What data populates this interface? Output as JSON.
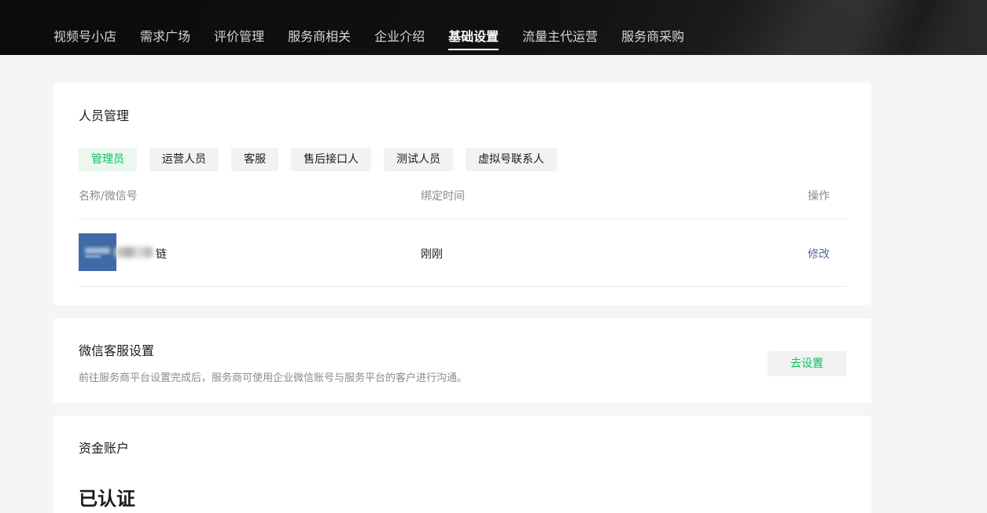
{
  "nav": {
    "items": [
      {
        "label": "视频号小店"
      },
      {
        "label": "需求广场"
      },
      {
        "label": "评价管理"
      },
      {
        "label": "服务商相关"
      },
      {
        "label": "企业介绍"
      },
      {
        "label": "基础设置",
        "active": true
      },
      {
        "label": "流量主代运营"
      },
      {
        "label": "服务商采购"
      }
    ]
  },
  "personnel": {
    "title": "人员管理",
    "tabs": [
      {
        "label": "管理员",
        "active": true
      },
      {
        "label": "运营人员"
      },
      {
        "label": "客服"
      },
      {
        "label": "售后接口人"
      },
      {
        "label": "测试人员"
      },
      {
        "label": "虚拟号联系人"
      }
    ],
    "columns": {
      "name": "名称/微信号",
      "bind_time": "绑定时间",
      "action": "操作"
    },
    "rows": [
      {
        "name_tail": "链",
        "bind_time": "刚刚",
        "action": "修改"
      }
    ]
  },
  "wechat_service": {
    "title": "微信客服设置",
    "description": "前往服务商平台设置完成后，服务商可使用企业微信账号与服务平台的客户进行沟通。",
    "button": "去设置"
  },
  "fund_account": {
    "title": "资金账户",
    "status": "已认证"
  },
  "colors": {
    "accent_green": "#07c160",
    "link_blue": "#576b95",
    "nav_bg": "#111111"
  }
}
